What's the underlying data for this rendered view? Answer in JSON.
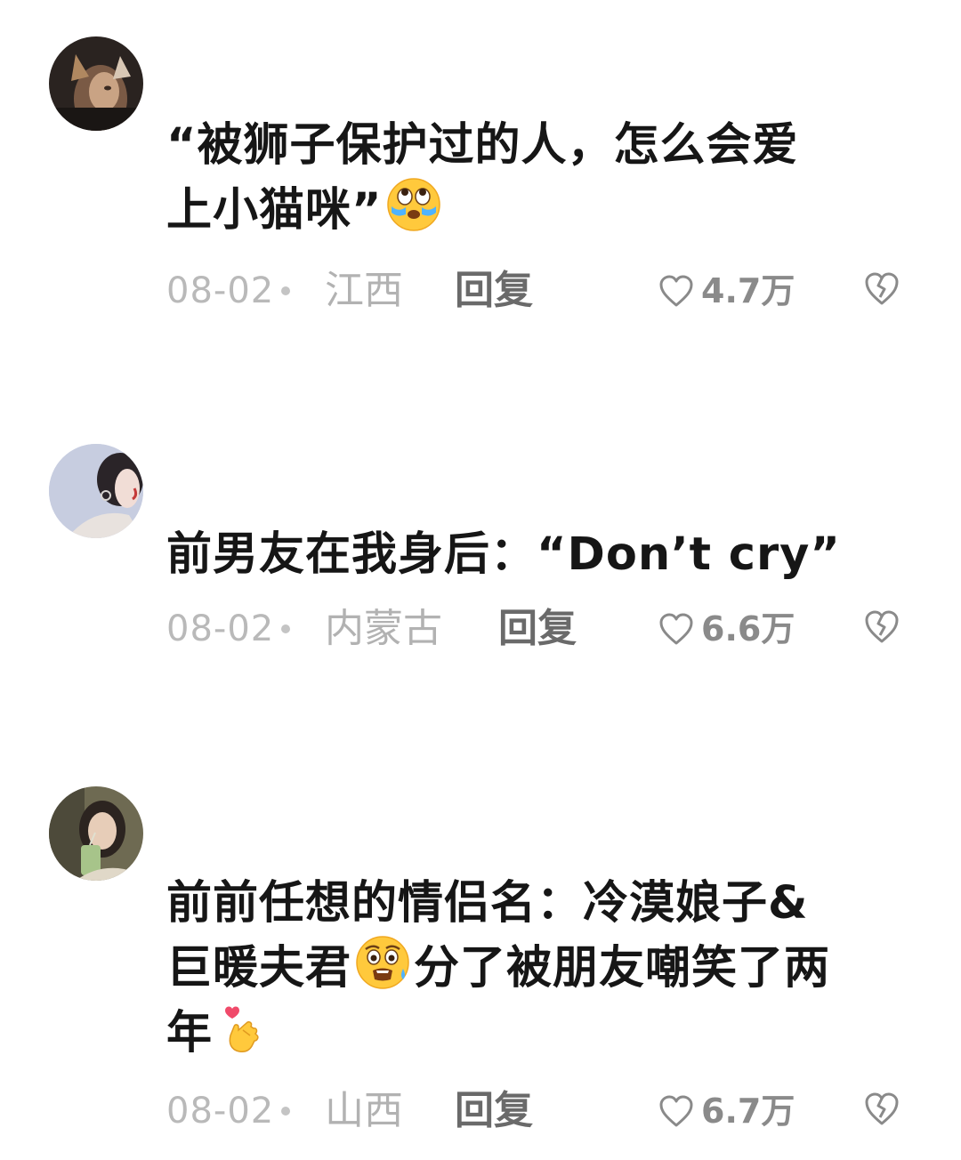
{
  "comments": [
    {
      "avatar_icon": "avatar-user-1",
      "text_parts": [
        "“被狮子保护过的人，怎么会爱",
        "上小猫咪”"
      ],
      "emoji": "eyes-up-crying-emoji",
      "date": "08-02",
      "region": "江西",
      "reply_label": "回复",
      "likes": "4.7万"
    },
    {
      "avatar_icon": "avatar-user-2",
      "text": "前男友在我身后：“Don’t cry”",
      "date": "08-02",
      "region": "内蒙古",
      "reply_label": "回复",
      "likes": "6.6万"
    },
    {
      "avatar_icon": "avatar-user-3",
      "text_parts": [
        "前前任想的情侣名：冷漠娘子&",
        "巨暖夫君",
        "分了被朋友嘲笑了两",
        "年"
      ],
      "emojis": [
        "shocked-sweat-emoji",
        "finger-heart-emoji"
      ],
      "date": "08-02",
      "region": "山西",
      "reply_label": "回复",
      "likes": "6.7万"
    }
  ],
  "icons": {
    "like": "heart-outline-icon",
    "dislike": "broken-heart-icon"
  },
  "colors": {
    "text": "#161616",
    "meta_gray": "#b9b9b9",
    "reply_gray": "#6a6a6a",
    "like_gray": "#8a8a8a",
    "emoji_yellow": "#ffc93c"
  }
}
